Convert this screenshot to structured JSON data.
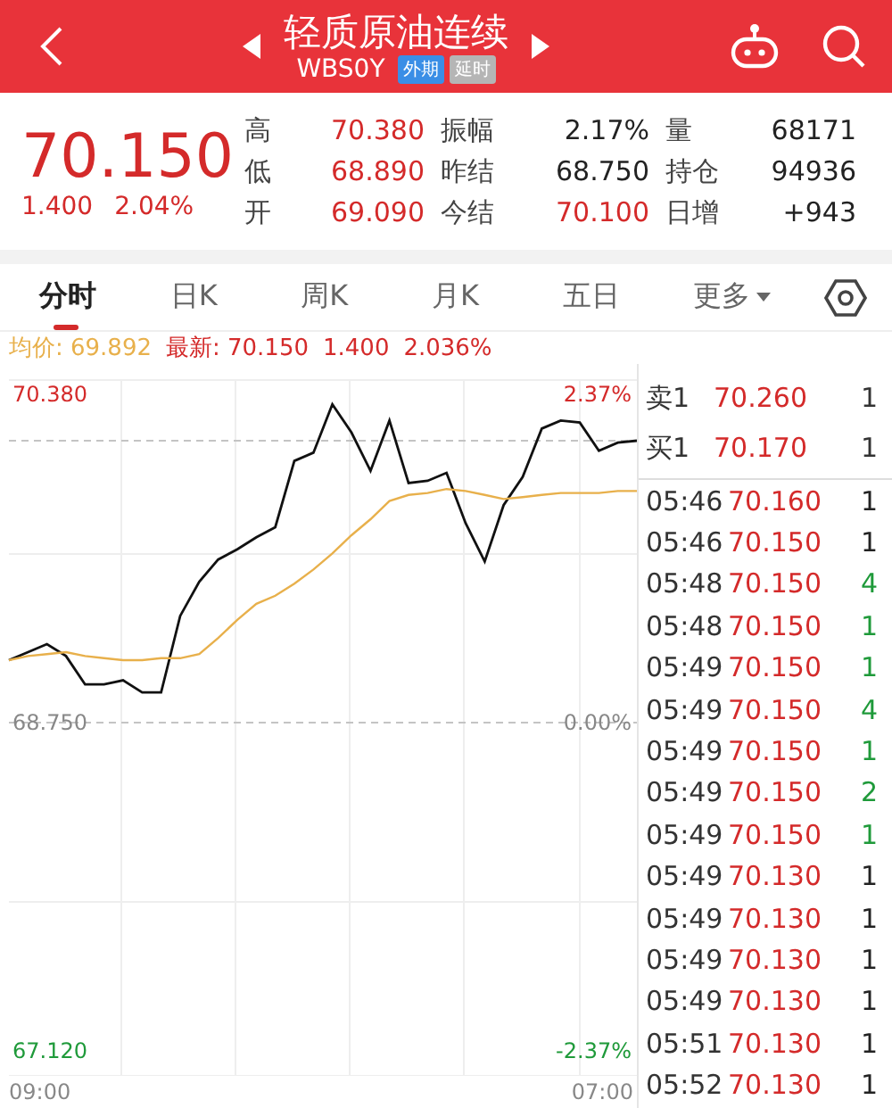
{
  "header": {
    "title": "轻质原油连续",
    "code": "WBS0Y",
    "badges": [
      {
        "label": "外期",
        "color": "#3a8ee6"
      },
      {
        "label": "延时",
        "color": "#b5b5b5"
      }
    ]
  },
  "quote": {
    "price": "70.150",
    "change": "1.400",
    "change_pct": "2.04%",
    "stats": [
      {
        "label": "高",
        "value": "70.380",
        "color": "#d42a2a"
      },
      {
        "label": "振幅",
        "value": "2.17%",
        "color": "#222222"
      },
      {
        "label": "量",
        "value": "68171",
        "color": "#222222"
      },
      {
        "label": "低",
        "value": "68.890",
        "color": "#d42a2a"
      },
      {
        "label": "昨结",
        "value": "68.750",
        "color": "#222222"
      },
      {
        "label": "持仓",
        "value": "94936",
        "color": "#222222"
      },
      {
        "label": "开",
        "value": "69.090",
        "color": "#d42a2a"
      },
      {
        "label": "今结",
        "value": "70.100",
        "color": "#d42a2a"
      },
      {
        "label": "日增",
        "value": "+943",
        "color": "#222222"
      }
    ]
  },
  "tabs": [
    {
      "label": "分时",
      "selected": true
    },
    {
      "label": "日K",
      "selected": false
    },
    {
      "label": "周K",
      "selected": false
    },
    {
      "label": "月K",
      "selected": false
    },
    {
      "label": "五日",
      "selected": false
    },
    {
      "label": "更多",
      "selected": false,
      "kind": "menu"
    }
  ],
  "info": {
    "avg_label": "均价: 69.892",
    "latest_label": "最新: 70.150",
    "latest_change": "1.400",
    "latest_pct": "2.036%"
  },
  "chart": {
    "change_labels": [
      "2.37%",
      "0.00%",
      "-2.37%"
    ],
    "time_labels": [
      "09:00",
      "07:00"
    ],
    "chart_data": {
      "type": "line",
      "ylim": [
        67.12,
        70.38
      ],
      "grid": true,
      "ref_lines": [
        {
          "axis": "y",
          "value": 70.15
        },
        {
          "axis": "y",
          "value": 68.75
        }
      ],
      "yticks": [
        {
          "value": 70.38,
          "label": "70.380"
        },
        {
          "value": 68.75,
          "label": "68.750"
        },
        {
          "value": 67.12,
          "label": "67.120"
        }
      ],
      "categories": [
        null,
        null,
        null,
        null,
        null,
        null,
        null,
        null,
        null,
        null,
        null,
        null,
        null,
        null,
        null,
        null,
        null,
        null,
        null,
        null,
        null,
        null,
        null,
        null,
        null,
        null,
        null,
        null,
        null,
        null,
        null,
        null,
        null,
        null
      ],
      "series": [
        {
          "color": "#111111",
          "values": [
            69.06,
            69.1,
            69.14,
            69.08,
            68.94,
            68.94,
            68.96,
            68.9,
            68.9,
            69.28,
            69.45,
            69.56,
            69.61,
            69.67,
            69.72,
            70.05,
            70.09,
            70.33,
            70.19,
            70.0,
            70.25,
            69.94,
            69.95,
            69.99,
            69.74,
            69.55,
            69.83,
            69.97,
            70.21,
            70.25,
            70.24,
            70.1,
            70.14,
            70.15
          ]
        },
        {
          "color": "#e8b04b",
          "values": [
            69.06,
            69.08,
            69.09,
            69.1,
            69.08,
            69.07,
            69.06,
            69.06,
            69.07,
            69.07,
            69.09,
            69.17,
            69.26,
            69.34,
            69.38,
            69.44,
            69.51,
            69.59,
            69.68,
            69.76,
            69.85,
            69.88,
            69.89,
            69.91,
            69.9,
            69.88,
            69.86,
            69.87,
            69.88,
            69.89,
            69.89,
            69.89,
            69.9,
            69.9
          ]
        }
      ]
    }
  },
  "order_book": [
    {
      "side": "卖1",
      "price": "70.260",
      "volume": "1"
    },
    {
      "side": "买1",
      "price": "70.170",
      "volume": "1"
    }
  ],
  "trades": [
    {
      "time": "05:46",
      "price": "70.160",
      "volume": "1",
      "color": "#222222"
    },
    {
      "time": "05:46",
      "price": "70.150",
      "volume": "1",
      "color": "#222222"
    },
    {
      "time": "05:48",
      "price": "70.150",
      "volume": "4",
      "color": "#1f9a3a"
    },
    {
      "time": "05:48",
      "price": "70.150",
      "volume": "1",
      "color": "#1f9a3a"
    },
    {
      "time": "05:49",
      "price": "70.150",
      "volume": "1",
      "color": "#1f9a3a"
    },
    {
      "time": "05:49",
      "price": "70.150",
      "volume": "4",
      "color": "#1f9a3a"
    },
    {
      "time": "05:49",
      "price": "70.150",
      "volume": "1",
      "color": "#1f9a3a"
    },
    {
      "time": "05:49",
      "price": "70.150",
      "volume": "2",
      "color": "#1f9a3a"
    },
    {
      "time": "05:49",
      "price": "70.150",
      "volume": "1",
      "color": "#1f9a3a"
    },
    {
      "time": "05:49",
      "price": "70.130",
      "volume": "1",
      "color": "#222222"
    },
    {
      "time": "05:49",
      "price": "70.130",
      "volume": "1",
      "color": "#222222"
    },
    {
      "time": "05:49",
      "price": "70.130",
      "volume": "1",
      "color": "#222222"
    },
    {
      "time": "05:49",
      "price": "70.130",
      "volume": "1",
      "color": "#222222"
    },
    {
      "time": "05:51",
      "price": "70.130",
      "volume": "1",
      "color": "#222222"
    },
    {
      "time": "05:52",
      "price": "70.130",
      "volume": "1",
      "color": "#222222"
    }
  ]
}
